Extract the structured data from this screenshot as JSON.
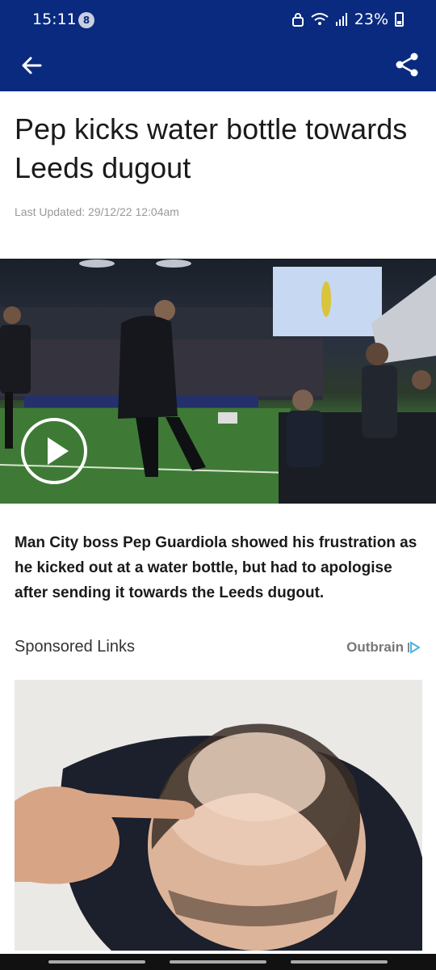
{
  "status_bar": {
    "time": "15:11",
    "notification_count": "8",
    "battery_percent": "23%"
  },
  "app_bar": {
    "back_icon": "arrow-left-icon",
    "share_icon": "share-icon",
    "background_color": "#0a2a7f"
  },
  "article": {
    "headline": "Pep kicks water bottle towards Leeds dugout",
    "last_updated": "Last Updated: 29/12/22 12:04am",
    "video_play_icon": "play-icon",
    "summary": "Man City boss Pep Guardiola showed his frustration as he kicked out at a water bottle, but had to apologise after sending it towards the Leeds dugout."
  },
  "sponsored": {
    "label": "Sponsored Links",
    "provider": "Outbrain",
    "provider_icon": "outbrain-icon"
  },
  "colors": {
    "brand": "#0a2a7f",
    "text": "#1a1a1a",
    "muted": "#999999"
  }
}
